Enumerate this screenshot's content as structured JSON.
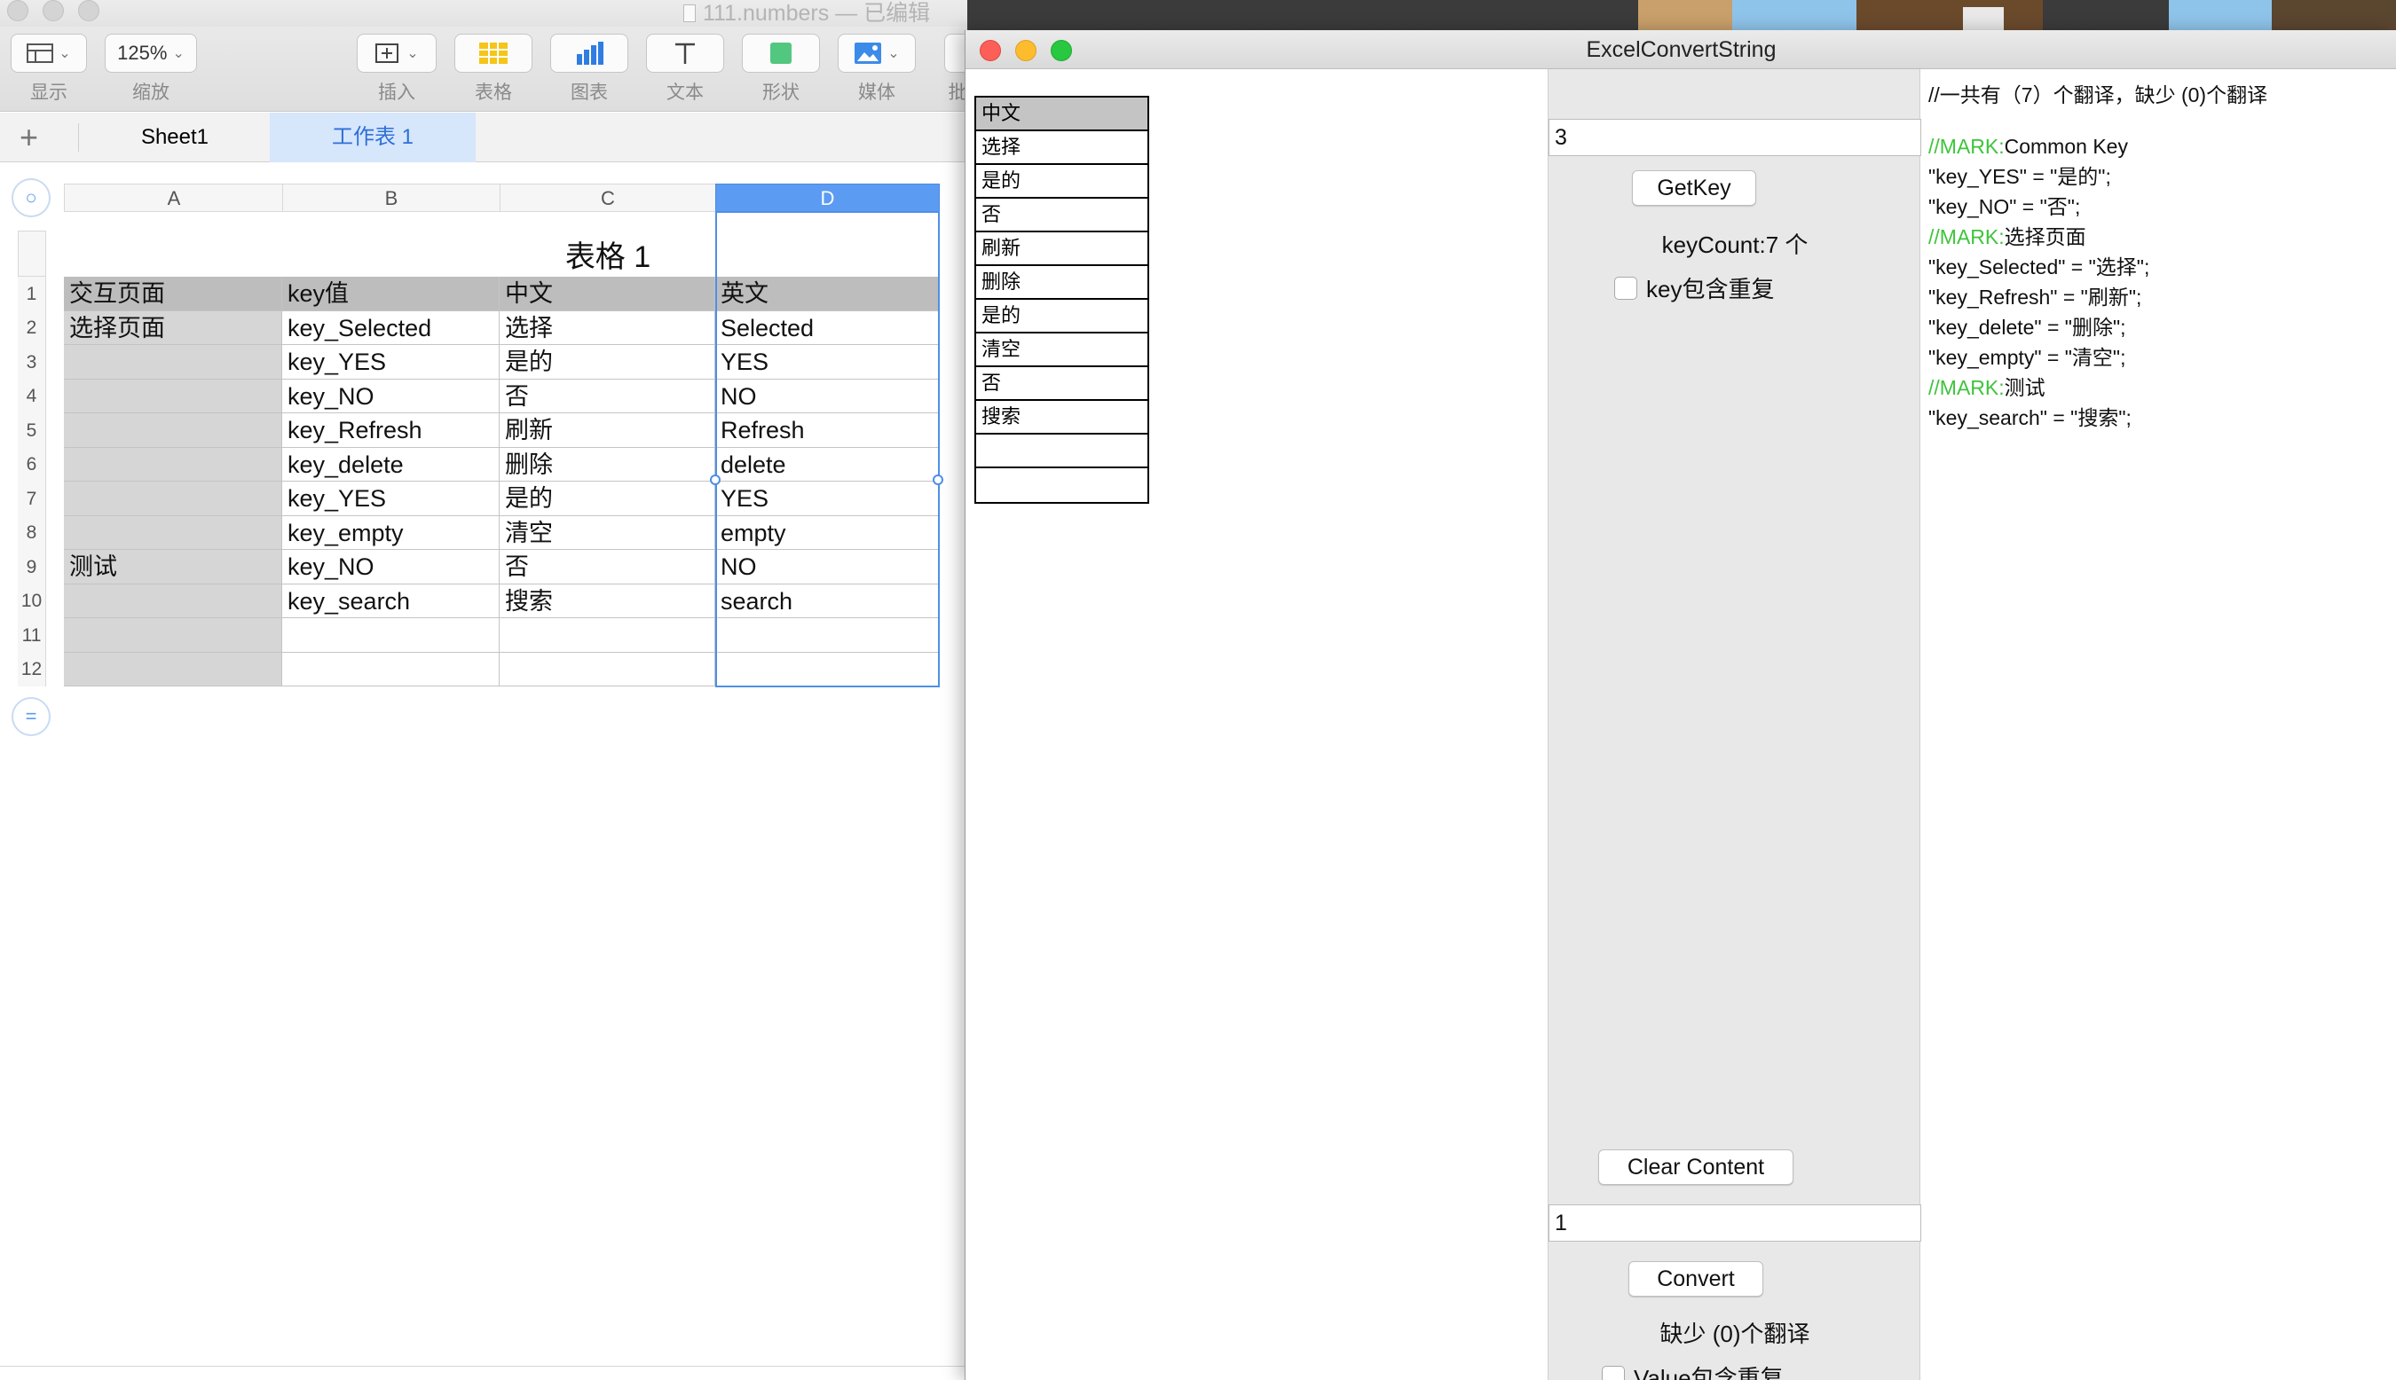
{
  "numbers": {
    "window_title": "111.numbers — 已编辑",
    "toolbar": {
      "view_label": "显示",
      "zoom_value": "125%",
      "zoom_label": "缩放",
      "insert_label": "插入",
      "table_label": "表格",
      "chart_label": "图表",
      "text_label": "文本",
      "shape_label": "形状",
      "media_label": "媒体",
      "overflow_label": "批"
    },
    "sheets": [
      "Sheet1",
      "工作表 1"
    ],
    "selected_sheet": "工作表 1",
    "columns": [
      "A",
      "B",
      "C",
      "D"
    ],
    "selected_column": "D",
    "table_title": "表格 1",
    "row_numbers": [
      "1",
      "2",
      "3",
      "4",
      "5",
      "6",
      "7",
      "8",
      "9",
      "10",
      "11",
      "12"
    ],
    "headers": [
      "交互页面",
      "key值",
      "中文",
      "英文"
    ],
    "rows": [
      [
        "选择页面",
        "key_Selected",
        "选择",
        "Selected"
      ],
      [
        "",
        "key_YES",
        "是的",
        "YES"
      ],
      [
        "",
        "key_NO",
        "否",
        "NO"
      ],
      [
        "",
        "key_Refresh",
        "刷新",
        "Refresh"
      ],
      [
        "",
        "key_delete",
        "删除",
        "delete"
      ],
      [
        "",
        "key_YES",
        "是的",
        "YES"
      ],
      [
        "",
        "key_empty",
        "清空",
        "empty"
      ],
      [
        "测试",
        "key_NO",
        "否",
        "NO"
      ],
      [
        "",
        "key_search",
        "搜索",
        "search"
      ],
      [
        "",
        "",
        "",
        ""
      ],
      [
        "",
        "",
        "",
        ""
      ]
    ]
  },
  "app": {
    "title": "ExcelConvertString",
    "preview_header": "中文",
    "preview_rows": [
      "选择",
      "是的",
      "否",
      "刷新",
      "删除",
      "是的",
      "清空",
      "否",
      "搜索",
      "",
      ""
    ],
    "key_column_value": "3",
    "get_key_label": "GetKey",
    "key_count_text": "keyCount:7 个",
    "key_dup_label": "key包含重复",
    "clear_label": "Clear Content",
    "value_column_value": "1",
    "convert_label": "Convert",
    "missing_text": "缺少 (0)个翻译",
    "value_dup_label": "Value包含重复",
    "output": {
      "summary": "//一共有（7）个翻译，缺少 (0)个翻译",
      "mark_prefix": "//MARK:",
      "mark1_name": "Common Key",
      "line_yes": "\"key_YES\" = \"是的\";",
      "line_no": "\"key_NO\" = \"否\";",
      "mark2_name": "选择页面",
      "line_selected": "\"key_Selected\" = \"选择\";",
      "line_refresh": "\"key_Refresh\" = \"刷新\";",
      "line_delete": "\"key_delete\" = \"删除\";",
      "line_empty": "\"key_empty\" = \"清空\";",
      "mark3_name": "测试",
      "line_search": "\"key_search\" = \"搜索\";"
    }
  },
  "colors": {
    "mark_green": "#3ec43b",
    "selection_blue": "#4d8fe8",
    "header_gray": "#bdbdbd"
  }
}
